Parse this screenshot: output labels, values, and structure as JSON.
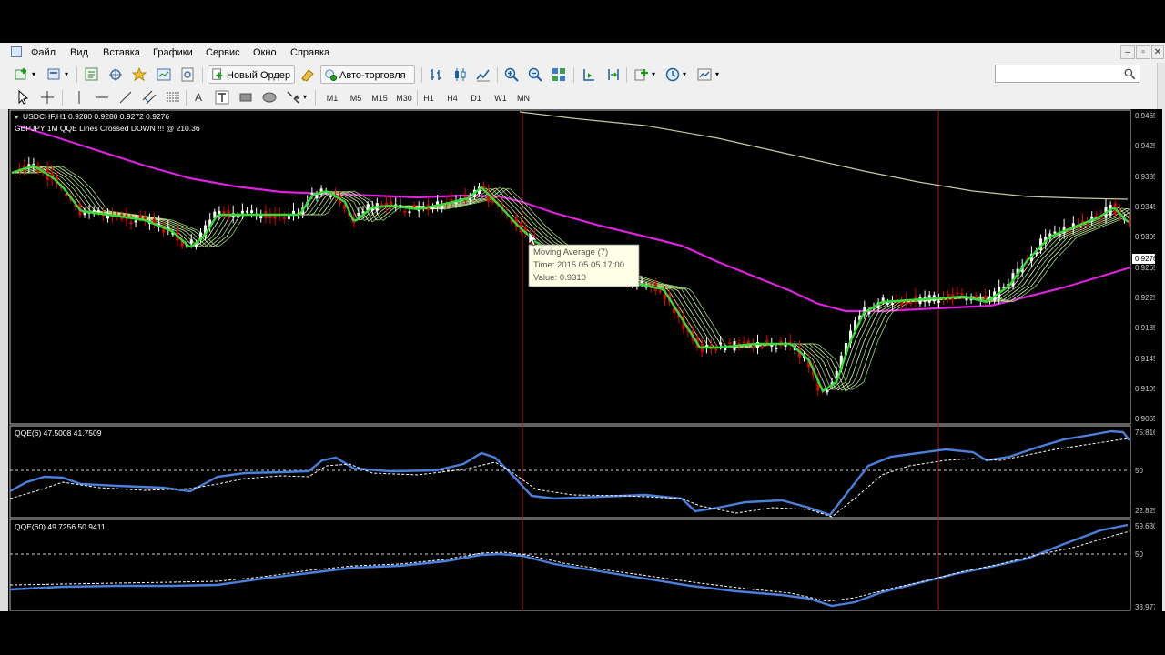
{
  "menu": [
    "Файл",
    "Вид",
    "Вставка",
    "Графики",
    "Сервис",
    "Окно",
    "Справка"
  ],
  "window_controls": [
    "–",
    "▫",
    "✕"
  ],
  "toolbar": {
    "new_order_label": "Новый Ордер",
    "autotrading_label": "Авто-торговля",
    "search_value": ""
  },
  "timeframes": [
    "M1",
    "M5",
    "M15",
    "M30",
    "H1",
    "H4",
    "D1",
    "W1",
    "MN"
  ],
  "chart": {
    "symbol_line": "USDCHF,H1  0.9280 0.9280 0.9272 0.9276",
    "alert_line": "GBPJPY 1M    QQE Lines Crossed DOWN !!!  @   210.36",
    "price_axis": [
      "0.9465",
      "0.9425",
      "0.9385",
      "0.9345",
      "0.9305",
      "0.9265",
      "0.9225",
      "0.9185",
      "0.9145",
      "0.9105",
      "0.9065"
    ],
    "current_price": "0.9276",
    "tooltip": {
      "title": "Moving Average (7)",
      "time": "Time: 2015.05.05 17:00",
      "value": "Value: 0.9310"
    }
  },
  "qqe_fast": {
    "label": "QQE(6) 47.5008 41.7509",
    "axis": [
      "75.816",
      "50",
      "22.825"
    ]
  },
  "qqe_slow": {
    "label": "QQE(60) 49.7256 50.9411",
    "axis": [
      "59.630",
      "50",
      "33.977"
    ]
  },
  "colors": {
    "bull": "#ffffff",
    "bear": "#e00000",
    "ma_fast": "#33dd33",
    "ma_slow": "#dd22dd",
    "ma_long": "#c8c8a0",
    "qqe_line": "#4a7fdc",
    "vline": "#b01818"
  }
}
